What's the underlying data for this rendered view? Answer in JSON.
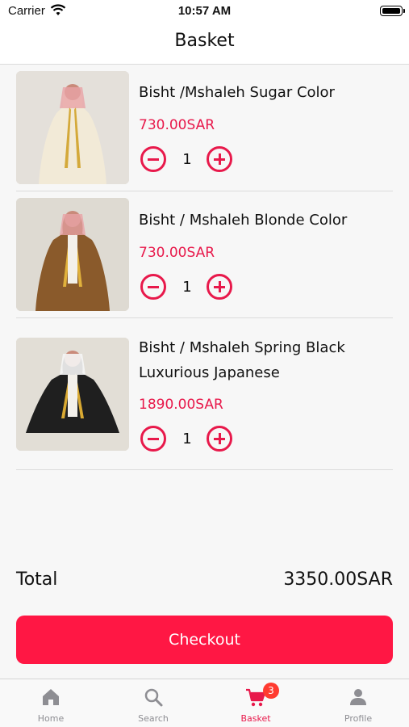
{
  "status_bar": {
    "carrier": "Carrier",
    "time": "10:57 AM"
  },
  "nav": {
    "title": "Basket"
  },
  "items": [
    {
      "name": "Bisht /Mshaleh  Sugar Color",
      "price": "730.00SAR",
      "quantity": "1",
      "cloak_color": "#f2ead7",
      "trim_color": "#d4a93a"
    },
    {
      "name": "Bisht / Mshaleh Blonde Color",
      "price": "730.00SAR",
      "quantity": "1",
      "cloak_color": "#8a5a2b",
      "trim_color": "#e0b13c"
    },
    {
      "name": "Bisht / Mshaleh Spring Black Luxurious Japanese",
      "price": "1890.00SAR",
      "quantity": "1",
      "cloak_color": "#1f1f1f",
      "trim_color": "#d9a932"
    }
  ],
  "summary": {
    "total_label": "Total",
    "total_value": "3350.00SAR"
  },
  "checkout": {
    "label": "Checkout"
  },
  "tabs": [
    {
      "label": "Home",
      "icon": "home-icon"
    },
    {
      "label": "Search",
      "icon": "search-icon"
    },
    {
      "label": "Basket",
      "icon": "cart-icon",
      "badge": "3",
      "active": true
    },
    {
      "label": "Profile",
      "icon": "person-icon"
    }
  ],
  "colors": {
    "accent": "#ff1744",
    "price": "#e8194b",
    "inactive_tab": "#8e8e93"
  }
}
